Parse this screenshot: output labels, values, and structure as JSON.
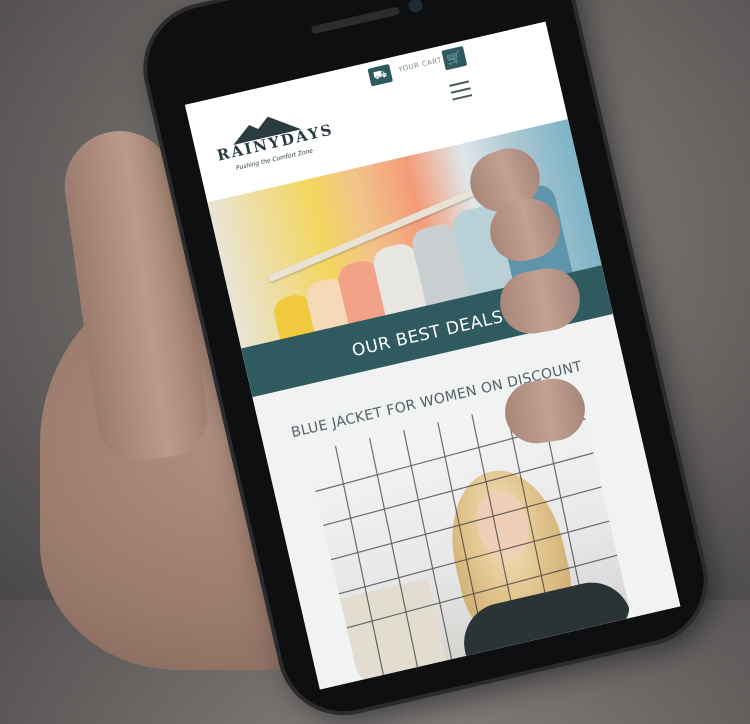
{
  "site": {
    "logo_name": "RAINYDAYS",
    "logo_tagline": "Pushing the Comfort Zone"
  },
  "header": {
    "cart_label": "YOUR CART"
  },
  "hero": {
    "banner_text": "OUR BEST DEALS"
  },
  "main": {
    "section_title": "BLUE JACKET FOR WOMEN ON DISCOUNT"
  },
  "colors": {
    "brand": "#2f5b60",
    "text_muted": "#4f6367",
    "page_bg": "#f1f2f2"
  },
  "icons": [
    "delivery-van-icon",
    "shopping-cart-icon",
    "hamburger-menu-icon",
    "mountain-logo-icon"
  ]
}
